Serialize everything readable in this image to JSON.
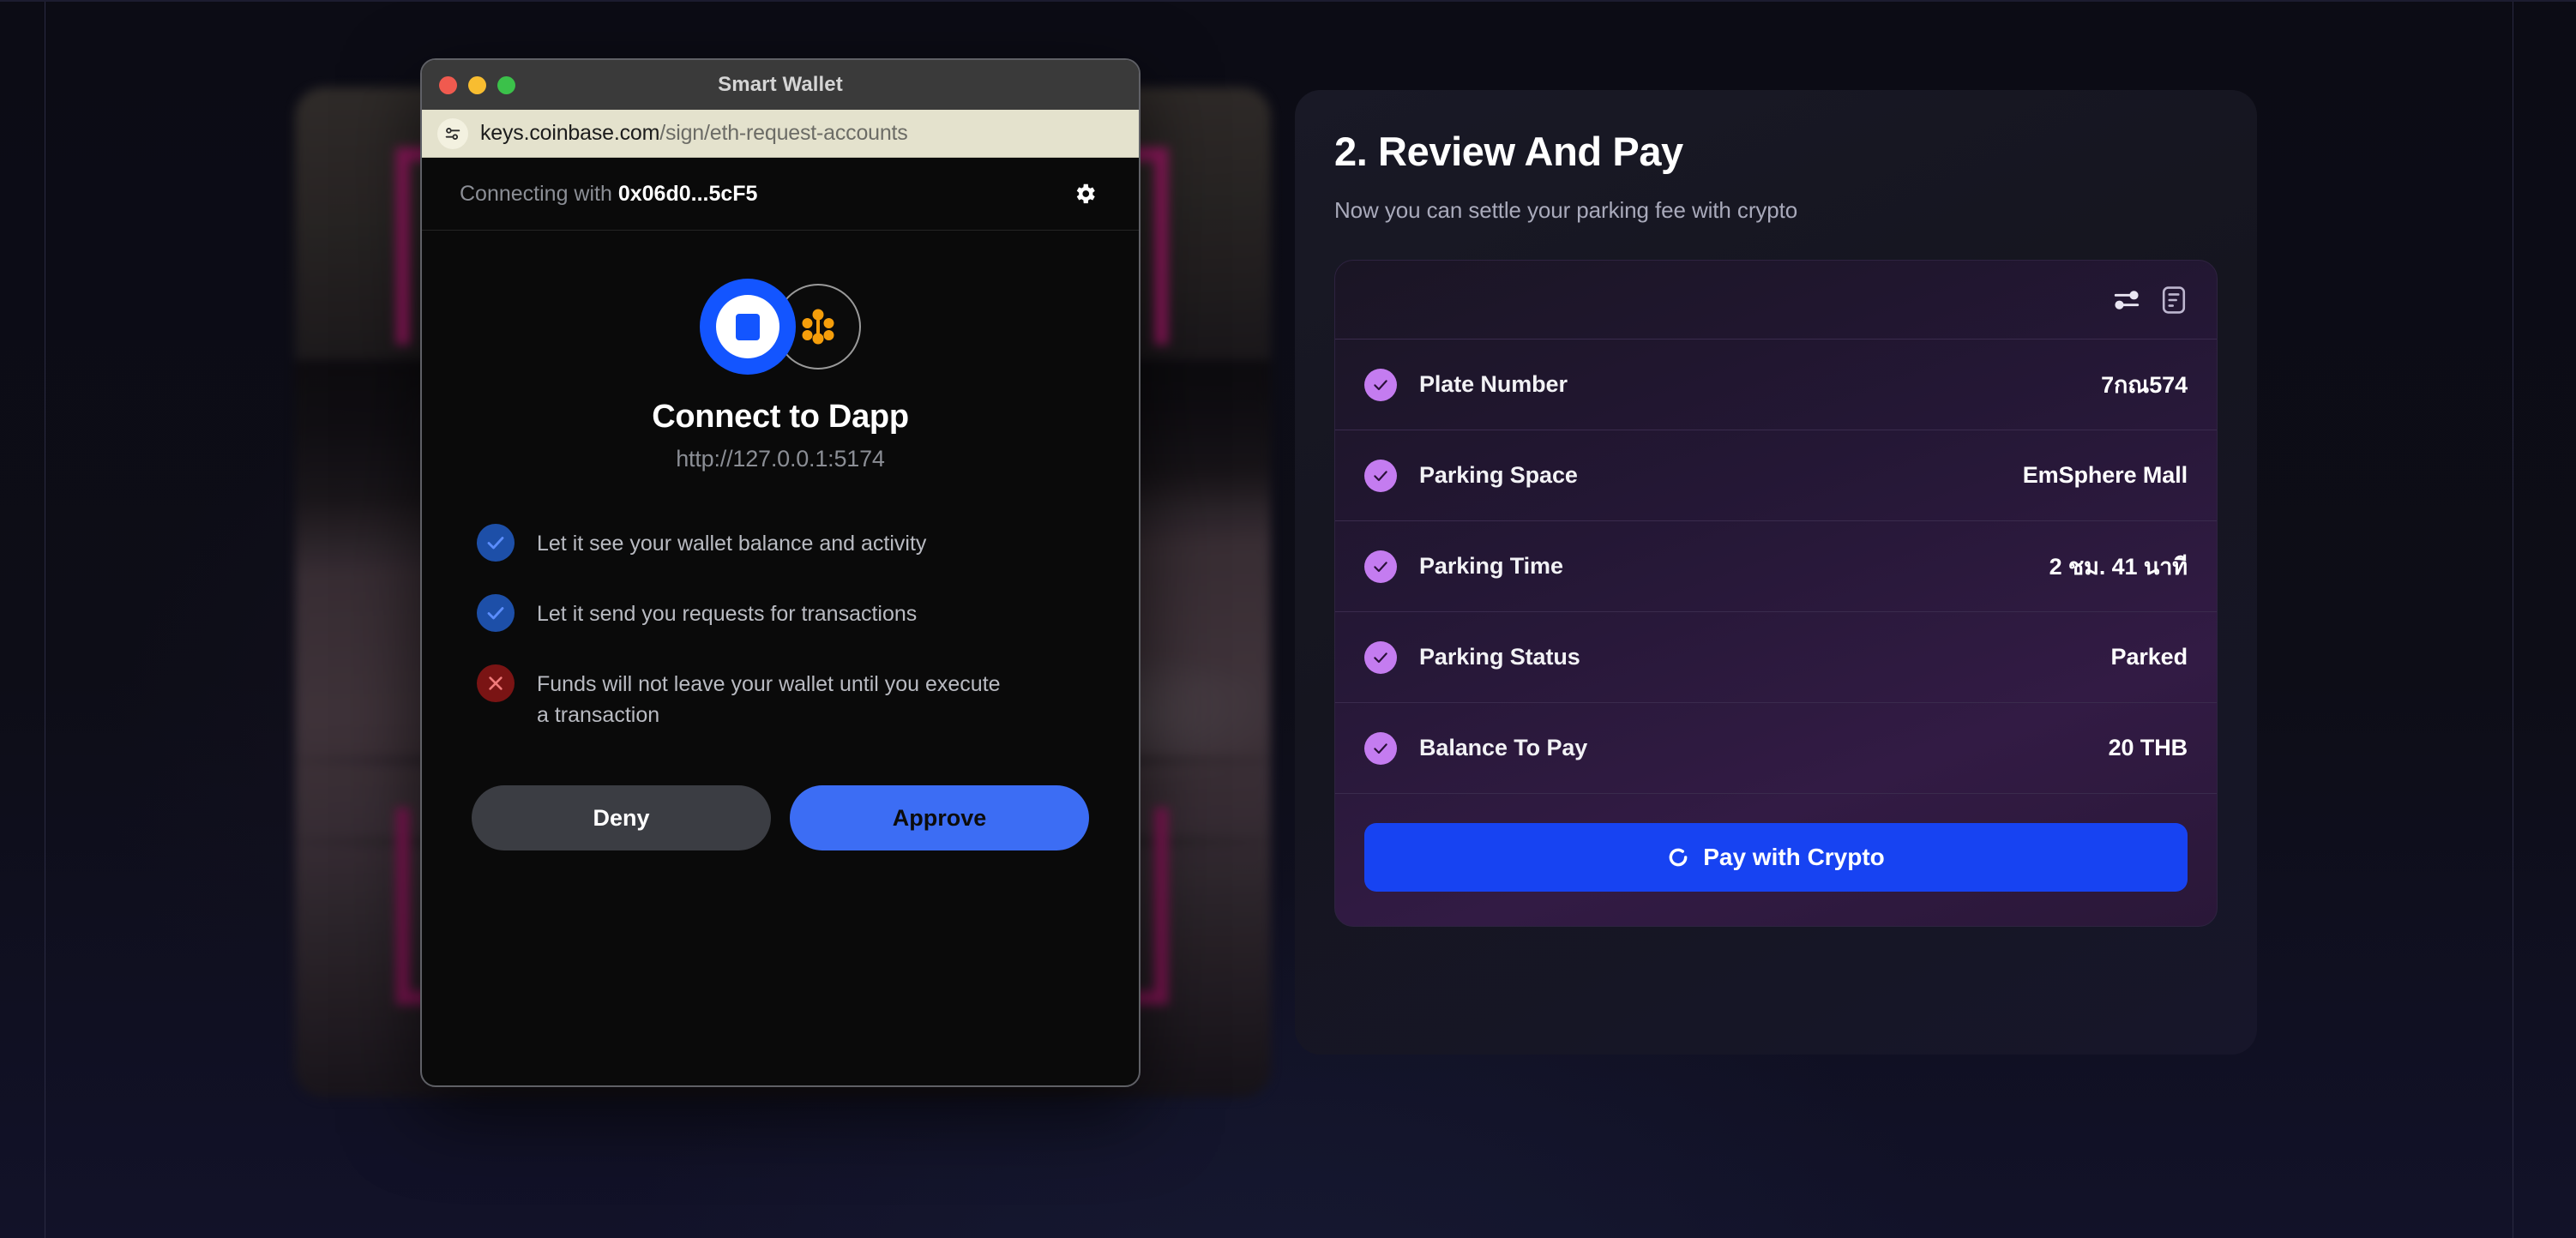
{
  "wallet_window": {
    "title": "Smart Wallet",
    "traffic_lights": [
      "close-button",
      "minimize-button",
      "zoom-button"
    ],
    "url": {
      "host": "keys.coinbase.com",
      "path": "/sign/eth-request-accounts",
      "badge_icon": "site-settings-icon"
    },
    "connect_bar": {
      "prefix": "Connecting with",
      "address": "0x06d0...5cF5",
      "settings_icon": "gear-icon"
    },
    "dapp": {
      "wallet_avatar_icon": "coinbase-wallet-icon",
      "dapp_avatar_icon": "dapp-cluster-icon",
      "title": "Connect to Dapp",
      "url": "http://127.0.0.1:5174"
    },
    "permissions": [
      {
        "icon": "check-icon",
        "type": "allow",
        "text": "Let it see your wallet balance and activity"
      },
      {
        "icon": "check-icon",
        "type": "allow",
        "text": "Let it send you requests for transactions"
      },
      {
        "icon": "x-icon",
        "type": "deny",
        "text": "Funds will not leave your wallet until you execute a transaction"
      }
    ],
    "actions": {
      "deny_label": "Deny",
      "approve_label": "Approve"
    }
  },
  "review_panel": {
    "title": "2. Review And Pay",
    "subtitle": "Now you can settle your parking fee with crypto",
    "card_header_icons": [
      "sliders-icon",
      "receipt-icon"
    ],
    "rows": [
      {
        "icon": "check-circle-icon",
        "label": "Plate Number",
        "value": "7กณ574"
      },
      {
        "icon": "check-circle-icon",
        "label": "Parking Space",
        "value": "EmSphere Mall"
      },
      {
        "icon": "check-circle-icon",
        "label": "Parking Time",
        "value": "2 ชม. 41 นาที"
      },
      {
        "icon": "check-circle-icon",
        "label": "Parking Status",
        "value": "Parked"
      },
      {
        "icon": "check-circle-icon",
        "label": "Balance To Pay",
        "value": "20 THB"
      }
    ],
    "pay_button": {
      "label": "Pay with Crypto",
      "icon": "spinner-icon"
    }
  },
  "colors": {
    "accent_blue": "#1743f2",
    "approve_blue": "#3c6df4",
    "check_purple": "#c47cf0",
    "scan_frame_pink": "#b41f74",
    "deny_red": "#7a1414",
    "page_bg": "#0d0d16"
  }
}
